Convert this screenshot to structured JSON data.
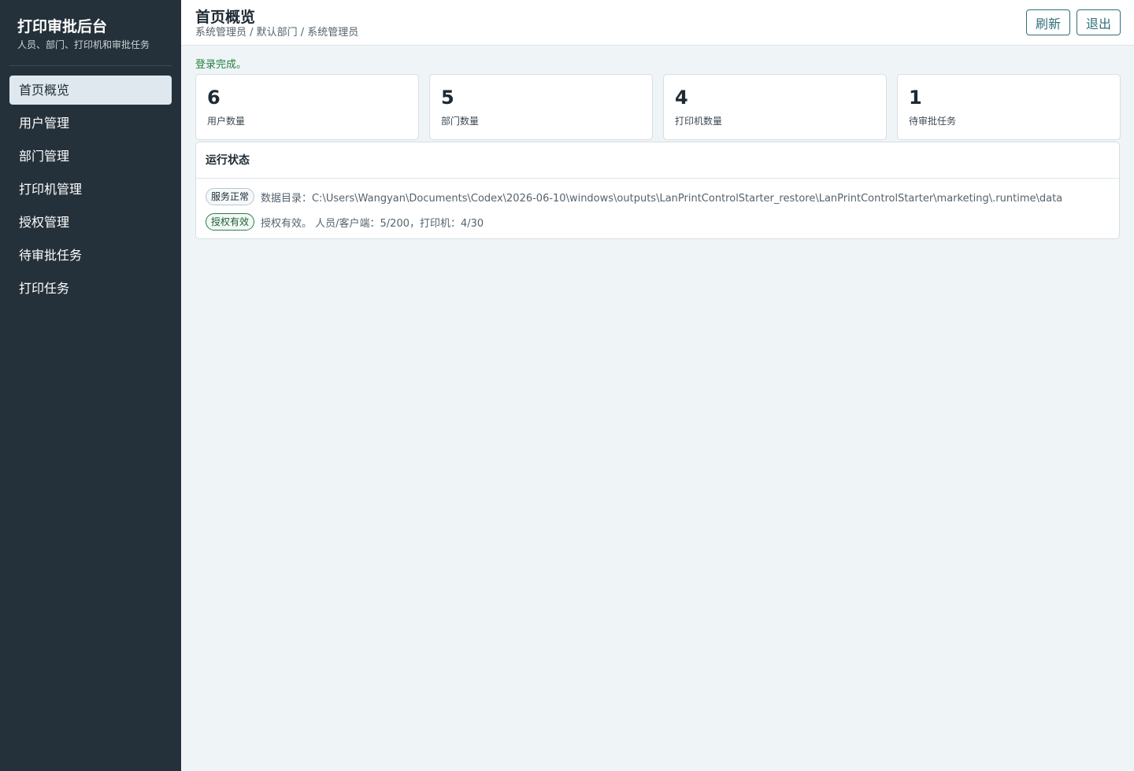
{
  "sidebar": {
    "title": "打印审批后台",
    "subtitle": "人员、部门、打印机和审批任务",
    "items": [
      {
        "label": "首页概览"
      },
      {
        "label": "用户管理"
      },
      {
        "label": "部门管理"
      },
      {
        "label": "打印机管理"
      },
      {
        "label": "授权管理"
      },
      {
        "label": "待审批任务"
      },
      {
        "label": "打印任务"
      }
    ]
  },
  "header": {
    "title": "首页概览",
    "breadcrumb": "系统管理员 / 默认部门 / 系统管理员",
    "refresh_label": "刷新",
    "logout_label": "退出"
  },
  "notice": "登录完成。",
  "stats": [
    {
      "value": "6",
      "label": "用户数量"
    },
    {
      "value": "5",
      "label": "部门数量"
    },
    {
      "value": "4",
      "label": "打印机数量"
    },
    {
      "value": "1",
      "label": "待审批任务"
    }
  ],
  "status_panel": {
    "title": "运行状态",
    "rows": [
      {
        "badge": "服务正常",
        "text": "数据目录：C:\\Users\\Wangyan\\Documents\\Codex\\2026-06-10\\windows\\outputs\\LanPrintControlStarter_restore\\LanPrintControlStarter\\marketing\\.runtime\\data"
      },
      {
        "badge": "授权有效",
        "text": "授权有效。 人员/客户端：5/200，打印机：4/30"
      }
    ]
  },
  "colors": {
    "sidebar_bg": "#25313a",
    "accent": "#2f6f78",
    "success": "#25803e"
  }
}
